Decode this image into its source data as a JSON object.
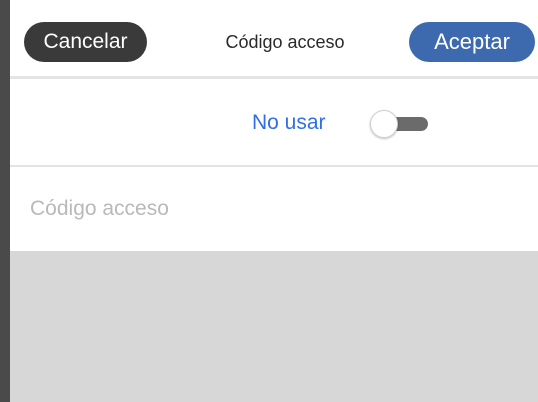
{
  "header": {
    "cancel_label": "Cancelar",
    "title": "Código acceso",
    "accept_label": "Aceptar"
  },
  "toggle_row": {
    "label": "No usar",
    "state": "off"
  },
  "passcode_field": {
    "value": "",
    "placeholder": "Código acceso"
  },
  "colors": {
    "cancel_button": "#3a3a3a",
    "accept_button": "#3d6aae",
    "toggle_label": "#2f6fe8",
    "keyboard_area": "#d6d7d6"
  }
}
